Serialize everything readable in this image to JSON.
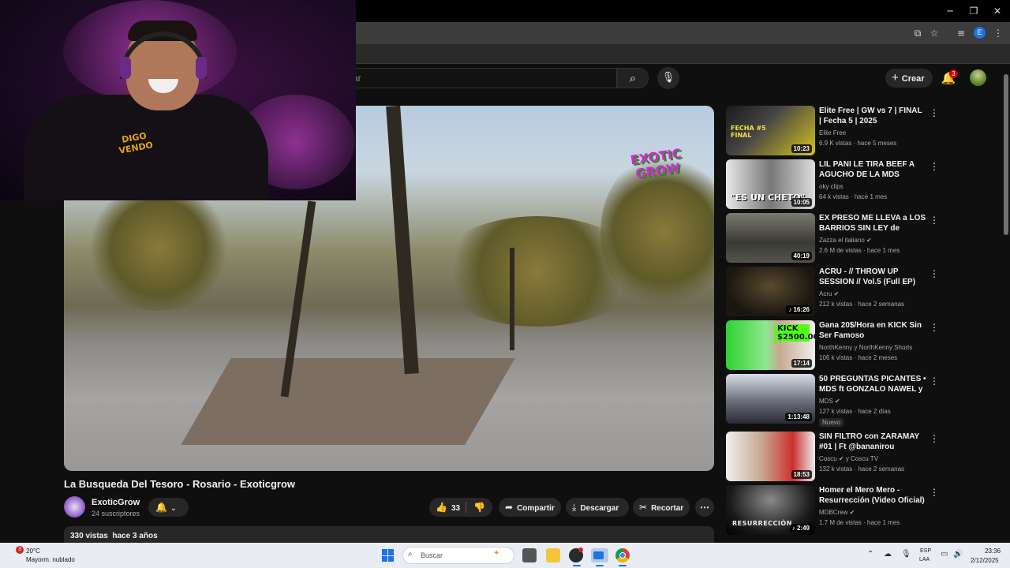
{
  "browser": {
    "window_controls": [
      "─",
      "❐",
      "✕"
    ],
    "extension_avatar": "E"
  },
  "youtube": {
    "search_placeholder": "car",
    "create_label": "Crear",
    "notification_count": "3"
  },
  "video": {
    "title": "La Busqueda Del Tesoro - Rosario - Exoticgrow",
    "overlay_logo": "EXOTIC GROW",
    "channel_name": "ExoticGrow",
    "subscribers": "24 suscriptores",
    "likes": "33",
    "share_label": "Compartir",
    "download_label": "Descargar",
    "clip_label": "Recortar",
    "stats": "330 vistas  hace 3 años"
  },
  "webcam": {
    "shirt_text": "DIGO VENDO"
  },
  "recommendations": [
    {
      "title": "Elite Free | GW vs 7 | FINAL | Fecha 5 | 2025",
      "channel": "Elite Free",
      "meta": "6.9 K vistas · hace 5 meses",
      "duration": "10:23",
      "thumb_text": "FECHA #5 FINAL",
      "new": ""
    },
    {
      "title": "LIL PANI LE TIRA BEEF A AGUCHO DE LA MDS",
      "channel": "oky clips",
      "meta": "64 k vistas · hace 1 mes",
      "duration": "10:05",
      "thumb_text": "\"ES UN CHETO\"",
      "new": ""
    },
    {
      "title": "EX PRESO ME LLEVA a LOS BARRIOS SIN LEY de ROSARI...",
      "channel": "Zazza el italiano ✔",
      "meta": "2.6 M de vistas · hace 1 mes",
      "duration": "40:19",
      "thumb_text": "",
      "new": ""
    },
    {
      "title": "ACRU - // THROW UP SESSION // Vol.5 (Full EP)",
      "channel": "Acru ✔",
      "meta": "212 k vistas · hace 2 semanas",
      "duration": "♪ 16:26",
      "thumb_text": "",
      "new": ""
    },
    {
      "title": "Gana 20$/Hora en KICK Sin Ser Famoso",
      "channel": "NorthKenny y NorthKenny Shorts",
      "meta": "106 k vistas · hace 2 meses",
      "duration": "17:14",
      "thumb_text": "KICK $2500.00",
      "new": ""
    },
    {
      "title": "50 PREGUNTAS PICANTES • MDS ft GONZALO NAWEL y EL...",
      "channel": "MDS ✔",
      "meta": "127 k vistas · hace 2 días",
      "duration": "1:13:48",
      "thumb_text": "",
      "new": "Nuevo"
    },
    {
      "title": "SIN FILTRO con ZARAMAY #01 | Ft @bananirou",
      "channel": "Coscu ✔ y Coscu TV",
      "meta": "132 k vistas · hace 2 semanas",
      "duration": "18:53",
      "thumb_text": "",
      "new": ""
    },
    {
      "title": "Homer el Mero Mero - Resurrección (Video Oficial)",
      "channel": "MDBCrew ✔",
      "meta": "1.7 M de vistas · hace 1 mes",
      "duration": "♪ 2:49",
      "thumb_text": "RESURRECCIÓN",
      "new": ""
    }
  ],
  "taskbar": {
    "weather_badge": "3",
    "temperature": "20°C",
    "weather_desc": "Mayorm. nublado",
    "search_label": "Buscar",
    "lang_line1": "ESP",
    "lang_line2": "LAA",
    "time": "23:36",
    "date": "2/12/2025"
  },
  "colors": {
    "accent_red": "#cc0000",
    "background": "#0f0f0f",
    "chip": "#272727"
  }
}
